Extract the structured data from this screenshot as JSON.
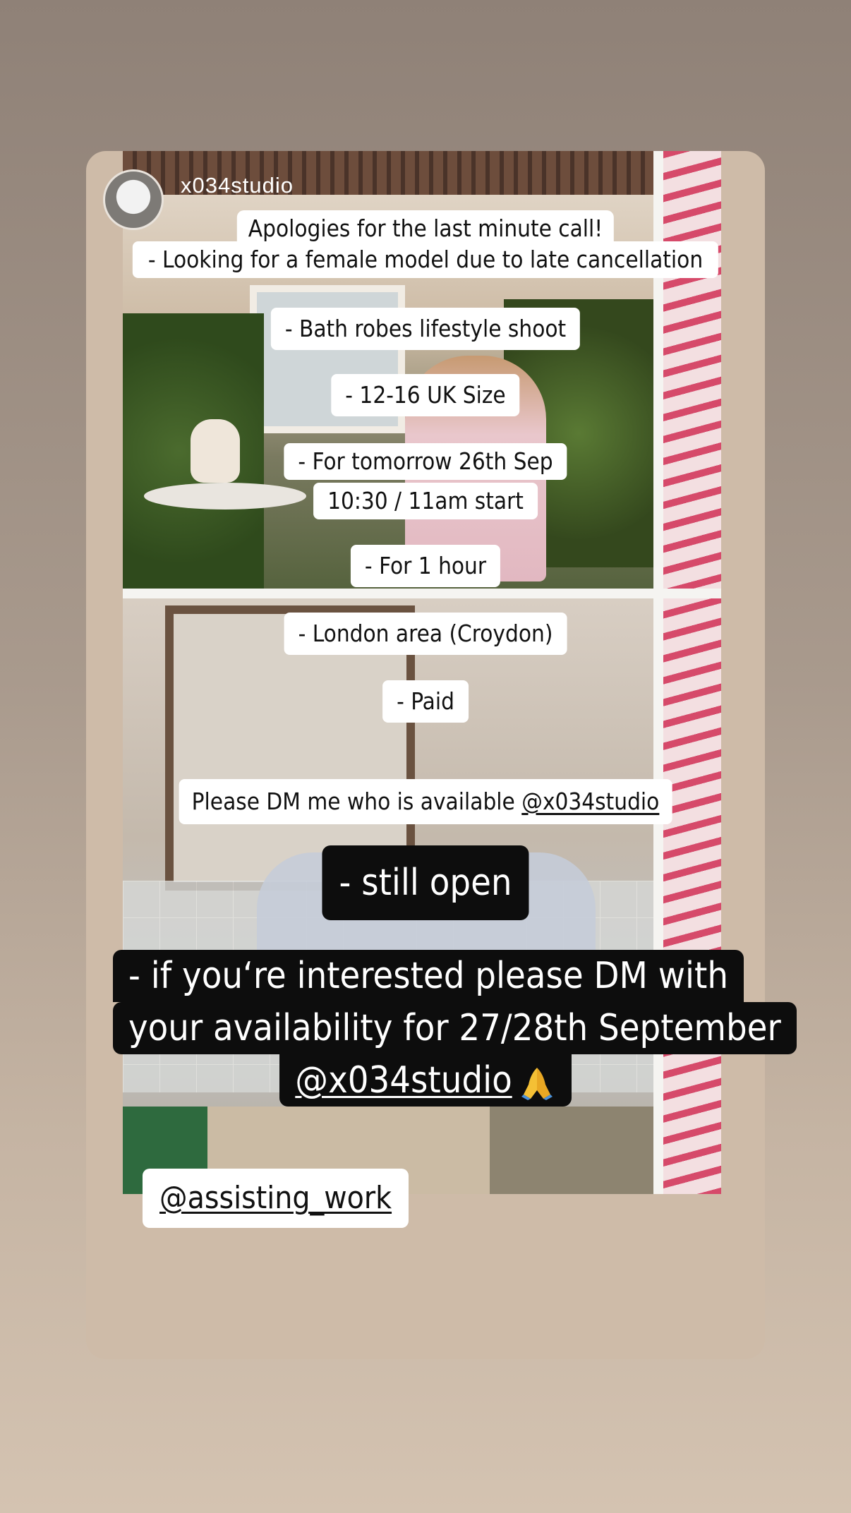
{
  "story": {
    "username": "x034studio",
    "lines": [
      "Apologies for the last minute call!",
      "- Looking for a female model due to late cancellation",
      "- Bath robes lifestyle shoot",
      "- 12-16 UK Size",
      "- For tomorrow 26th Sep",
      "10:30 / 11am start",
      "- For 1 hour",
      "- London area (Croydon)",
      "- Paid"
    ],
    "dm_prefix": "Please DM me who is available ",
    "dm_mention": "@x034studio",
    "status": "- still open",
    "update_lines": [
      "- if you‘re interested please DM with",
      "your availability for 27/28th September"
    ],
    "update_mention": "@x034studio",
    "update_emoji": "folded-hands-icon",
    "mention_sticker": "@assisting_work"
  }
}
